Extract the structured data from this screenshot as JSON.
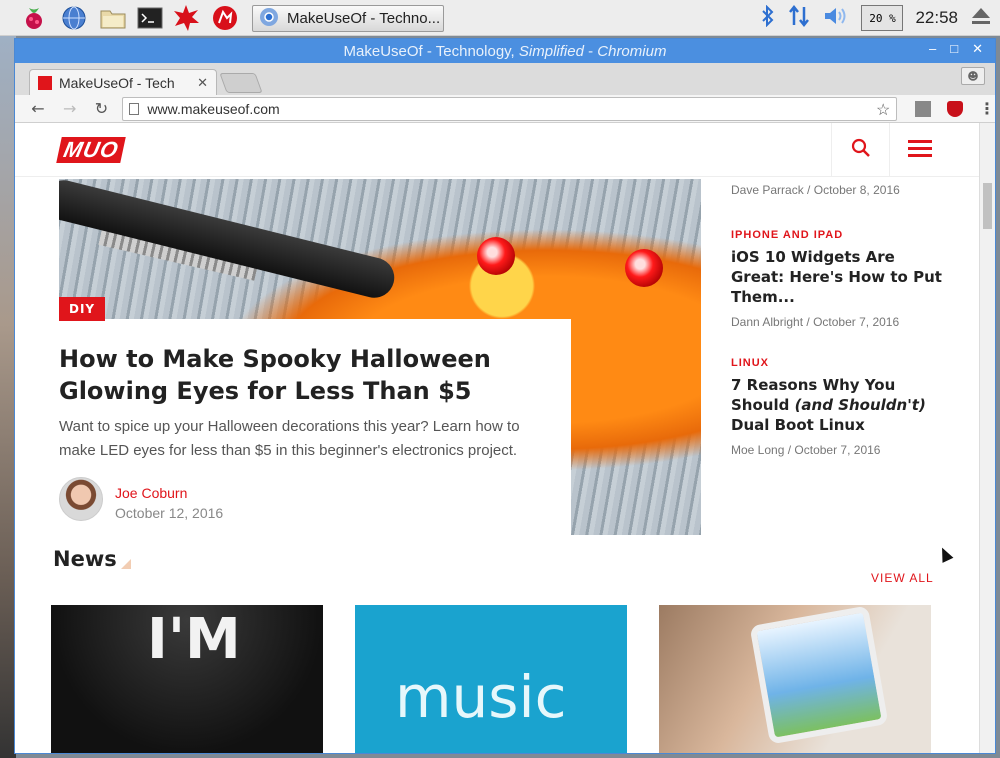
{
  "taskbar": {
    "task_title": "MakeUseOf - Techno...",
    "cpu_percent": "20",
    "cpu_unit": "%",
    "clock": "22:58"
  },
  "window": {
    "title_main": "MakeUseOf - Technology, ",
    "title_em": "Simplified",
    "title_tail": " - ",
    "title_app": "Chromium"
  },
  "tab": {
    "label": "MakeUseOf - Tech"
  },
  "omnibox": {
    "url": "www.makeuseof.com"
  },
  "site": {
    "logo": "MUO",
    "hero": {
      "category": "DIY",
      "title": "How to Make Spooky Halloween Glowing Eyes for Less Than $5",
      "description": "Want to spice up your Halloween decorations this year? Learn how to make LED eyes for less than $5 in this beginner's electronics project.",
      "author": "Joe Coburn",
      "date": "October 12, 2016"
    },
    "sidebar": {
      "top_meta": {
        "author": "Dave Parrack",
        "date": "October 8, 2016"
      },
      "items": [
        {
          "category": "IPHONE AND IPAD",
          "title": "iOS 10 Widgets Are Great: Here's How to Put Them...",
          "author": "Dann Albright",
          "date": "October 7, 2016"
        },
        {
          "category": "LINUX",
          "title_pre": "7 Reasons Why You Should ",
          "title_em": "(and Shouldn't)",
          "title_post": " Dual Boot Linux",
          "author": "Moe Long",
          "date": "October 7, 2016"
        }
      ]
    },
    "news": {
      "heading": "News",
      "view_all": "VIEW ALL",
      "thumb1_text": "I'M",
      "thumb2_text": "music"
    },
    "meta_separator": "/"
  },
  "colors": {
    "accent": "#e0151b",
    "titlebar": "#4b8fe0"
  }
}
